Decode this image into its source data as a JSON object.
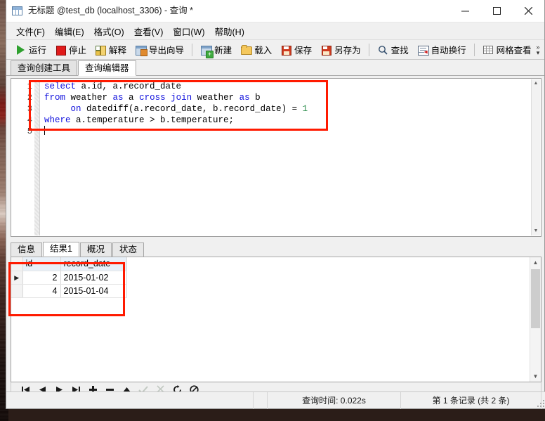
{
  "window": {
    "title": "无标题 @test_db (localhost_3306) - 查询 *",
    "title_icon": "table-grid-icon",
    "controls": {
      "minimize": "minimize-icon",
      "maximize": "maximize-icon",
      "close": "close-icon"
    }
  },
  "menubar": {
    "items": [
      {
        "label": "文件(F)",
        "name": "menu-file"
      },
      {
        "label": "编辑(E)",
        "name": "menu-edit"
      },
      {
        "label": "格式(O)",
        "name": "menu-format"
      },
      {
        "label": "查看(V)",
        "name": "menu-view"
      },
      {
        "label": "窗口(W)",
        "name": "menu-window"
      },
      {
        "label": "帮助(H)",
        "name": "menu-help"
      }
    ]
  },
  "toolbar": {
    "buttons": [
      {
        "label": "运行",
        "icon": "play-icon"
      },
      {
        "label": "停止",
        "icon": "stop-icon"
      },
      {
        "label": "解释",
        "icon": "explain-icon"
      },
      {
        "label": "导出向导",
        "icon": "export-wizard-icon"
      },
      {
        "label": "新建",
        "icon": "new-query-icon"
      },
      {
        "label": "载入",
        "icon": "open-folder-icon"
      },
      {
        "label": "保存",
        "icon": "save-icon"
      },
      {
        "label": "另存为",
        "icon": "save-as-icon"
      },
      {
        "label": "查找",
        "icon": "search-icon"
      },
      {
        "label": "自动换行",
        "icon": "word-wrap-icon"
      },
      {
        "label": "网格查看",
        "icon": "grid-view-icon"
      }
    ],
    "overflow": "»"
  },
  "main_tabs": [
    {
      "label": "查询创建工具",
      "active": false
    },
    {
      "label": "查询编辑器",
      "active": true
    }
  ],
  "editor": {
    "line_numbers": [
      "1",
      "2",
      "3",
      "4",
      "5"
    ],
    "lines": [
      {
        "tokens": [
          {
            "t": "select",
            "k": "kw"
          },
          {
            "t": " a.id, a.record_date",
            "k": ""
          }
        ]
      },
      {
        "tokens": [
          {
            "t": "from",
            "k": "kw"
          },
          {
            "t": " weather ",
            "k": ""
          },
          {
            "t": "as",
            "k": "kw"
          },
          {
            "t": " a ",
            "k": ""
          },
          {
            "t": "cross",
            "k": "kw"
          },
          {
            "t": " ",
            "k": ""
          },
          {
            "t": "join",
            "k": "kw"
          },
          {
            "t": " weather ",
            "k": ""
          },
          {
            "t": "as",
            "k": "kw"
          },
          {
            "t": " b",
            "k": ""
          }
        ]
      },
      {
        "tokens": [
          {
            "t": "     ",
            "k": ""
          },
          {
            "t": "on",
            "k": "kw"
          },
          {
            "t": " datediff(a.record_date, b.record_date) = ",
            "k": ""
          },
          {
            "t": "1",
            "k": "num"
          }
        ]
      },
      {
        "tokens": [
          {
            "t": "where",
            "k": "kw"
          },
          {
            "t": " a.temperature > b.temperature;",
            "k": ""
          }
        ]
      },
      {
        "tokens": []
      }
    ],
    "scroll_up_icon": "chevron-up-icon",
    "scroll_down_icon": "chevron-down-icon"
  },
  "result_tabs": [
    {
      "label": "信息",
      "active": false
    },
    {
      "label": "结果1",
      "active": true
    },
    {
      "label": "概况",
      "active": false
    },
    {
      "label": "状态",
      "active": false
    }
  ],
  "result_grid": {
    "columns": [
      "id",
      "record_date"
    ],
    "rows": [
      {
        "current": true,
        "id": "2",
        "record_date": "2015-01-02"
      },
      {
        "current": false,
        "id": "4",
        "record_date": "2015-01-04"
      }
    ],
    "current_row_marker": "▶"
  },
  "nav_toolbar": [
    {
      "name": "first-record-button",
      "icon": "first-icon",
      "disabled": false
    },
    {
      "name": "prev-record-button",
      "icon": "prev-icon",
      "disabled": false
    },
    {
      "name": "next-record-button",
      "icon": "next-icon",
      "disabled": false
    },
    {
      "name": "last-record-button",
      "icon": "last-icon",
      "disabled": false
    },
    {
      "name": "add-record-button",
      "icon": "plus-icon",
      "disabled": false
    },
    {
      "name": "delete-record-button",
      "icon": "minus-icon",
      "disabled": false
    },
    {
      "name": "apply-record-button",
      "icon": "caret-up-icon",
      "disabled": false
    },
    {
      "name": "confirm-button",
      "icon": "check-icon",
      "disabled": true
    },
    {
      "name": "cancel-edit-button",
      "icon": "scissors-icon",
      "disabled": true
    },
    {
      "name": "refresh-button",
      "icon": "refresh-icon",
      "disabled": false
    },
    {
      "name": "stop-loading-button",
      "icon": "no-entry-icon",
      "disabled": false
    }
  ],
  "statusbar": {
    "query_time": "查询时间: 0.022s",
    "record_info": "第 1 条记录 (共 2 条)"
  },
  "annotations": [
    {
      "name": "sql-highlight-box",
      "color": "#ff1a00"
    },
    {
      "name": "result-highlight-box",
      "color": "#ff1a00"
    }
  ]
}
